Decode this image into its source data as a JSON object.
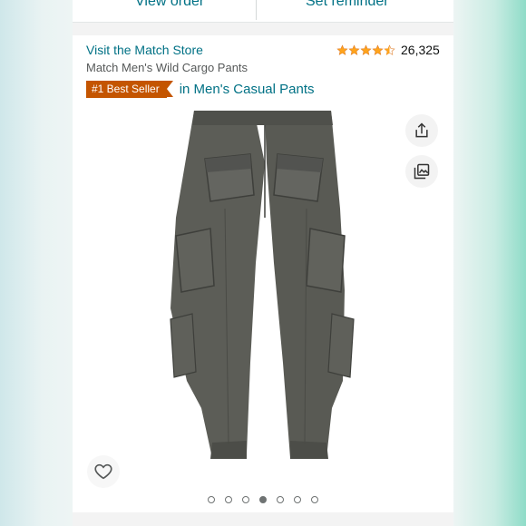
{
  "order_actions": {
    "view_order": "View order",
    "set_reminder": "Set reminder"
  },
  "product": {
    "store_link": "Visit the Match Store",
    "title": "Match Men's Wild Cargo Pants",
    "rating": 4.5,
    "review_count": "26,325",
    "badge": "#1 Best Seller",
    "badge_category": "in Men's Casual Pants"
  },
  "gallery": {
    "image_count": 7,
    "active_index": 3
  },
  "icons": {
    "share": "share-icon",
    "gallery": "image-gallery-icon",
    "wishlist": "heart-icon",
    "stars": "star-icon"
  },
  "colors": {
    "link": "#007185",
    "badge": "#c45500",
    "star": "#ffa41c",
    "pants": "#5a5b55"
  }
}
